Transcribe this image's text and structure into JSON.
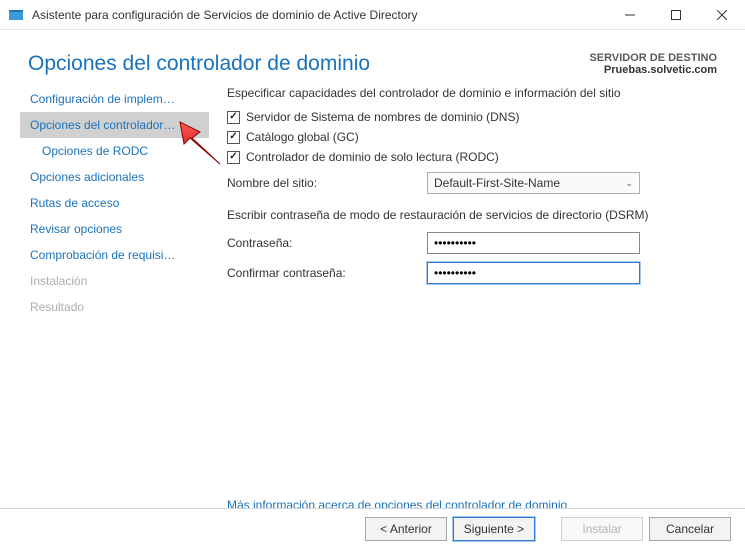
{
  "window": {
    "title": "Asistente para configuración de Servicios de dominio de Active Directory"
  },
  "header": {
    "page_title": "Opciones del controlador de dominio",
    "dest_label": "SERVIDOR DE DESTINO",
    "dest_name": "Pruebas.solvetic.com"
  },
  "sidebar": {
    "items": [
      {
        "label": "Configuración de implem…",
        "selected": false,
        "disabled": false,
        "sub": false
      },
      {
        "label": "Opciones del controlador…",
        "selected": true,
        "disabled": false,
        "sub": false
      },
      {
        "label": "Opciones de RODC",
        "selected": false,
        "disabled": false,
        "sub": true
      },
      {
        "label": "Opciones adicionales",
        "selected": false,
        "disabled": false,
        "sub": false
      },
      {
        "label": "Rutas de acceso",
        "selected": false,
        "disabled": false,
        "sub": false
      },
      {
        "label": "Revisar opciones",
        "selected": false,
        "disabled": false,
        "sub": false
      },
      {
        "label": "Comprobación de requisi…",
        "selected": false,
        "disabled": false,
        "sub": false
      },
      {
        "label": "Instalación",
        "selected": false,
        "disabled": true,
        "sub": false
      },
      {
        "label": "Resultado",
        "selected": false,
        "disabled": true,
        "sub": false
      }
    ]
  },
  "content": {
    "caps_title": "Especificar capacidades del controlador de dominio e información del sitio",
    "chk_dns": "Servidor de Sistema de nombres de dominio (DNS)",
    "chk_gc": "Catálogo global (GC)",
    "chk_rodc": "Controlador de dominio de solo lectura (RODC)",
    "site_label": "Nombre del sitio:",
    "site_value": "Default-First-Site-Name",
    "dsrm_title": "Escribir contraseña de modo de restauración de servicios de directorio (DSRM)",
    "pwd_label": "Contraseña:",
    "pwd_value": "••••••••••",
    "confirm_label": "Confirmar contraseña:",
    "confirm_value": "••••••••••",
    "more_link": "Más información acerca de opciones del controlador de dominio"
  },
  "footer": {
    "prev": "< Anterior",
    "next": "Siguiente >",
    "install": "Instalar",
    "cancel": "Cancelar"
  }
}
